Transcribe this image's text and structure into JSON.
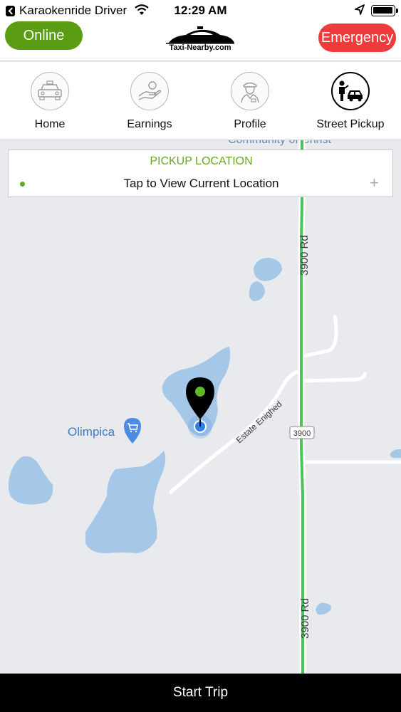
{
  "status_bar": {
    "app_name": "Karaokenride Driver",
    "time": "12:29 AM"
  },
  "header": {
    "online_label": "Online",
    "emergency_label": "Emergency",
    "logo_text": "Taxi-Nearby.com",
    "colors": {
      "online": "#5a9c12",
      "emergency": "#ef3b3b"
    }
  },
  "nav": {
    "items": [
      {
        "label": "Home",
        "icon": "taxi-car-icon"
      },
      {
        "label": "Earnings",
        "icon": "hand-money-icon"
      },
      {
        "label": "Profile",
        "icon": "driver-icon"
      },
      {
        "label": "Street Pickup",
        "icon": "street-pickup-icon"
      }
    ]
  },
  "pickup": {
    "title": "PICKUP LOCATION",
    "location_text": "Tap to View Current Location",
    "accent": "#6aa824"
  },
  "map": {
    "labels": {
      "top_partial": "Community of Christ",
      "road_top": "3900 Rd",
      "road_bottom": "3900 Rd",
      "road_shield": "3900",
      "estate_road": "Estate Enighed",
      "place": "Olimpica"
    }
  },
  "footer": {
    "start_trip_label": "Start Trip"
  }
}
